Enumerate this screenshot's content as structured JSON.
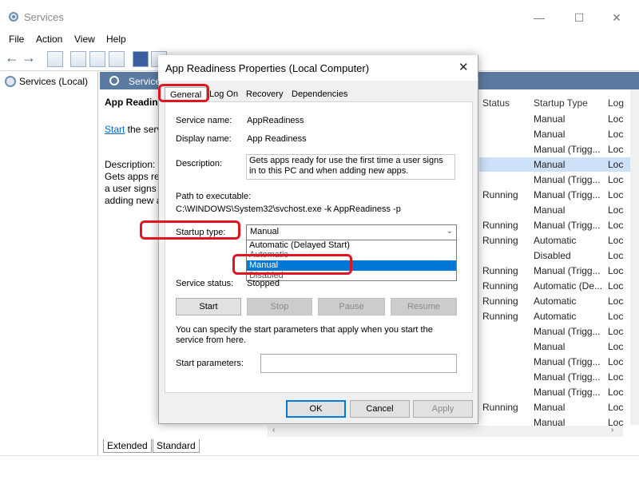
{
  "window": {
    "title": "Services",
    "icons": {
      "app": "services-gear-icon",
      "minimize": "minimize-icon",
      "maximize": "maximize-icon",
      "close": "close-icon"
    },
    "controls": {
      "minimize": "—",
      "maximize": "☐",
      "close": "✕"
    }
  },
  "menu": [
    "File",
    "Action",
    "View",
    "Help"
  ],
  "toolbar": {
    "back": "←",
    "forward": "→",
    "icons": [
      "back-icon",
      "forward-icon",
      "console-tree-icon",
      "properties-icon",
      "refresh-icon",
      "export-icon",
      "help-icon",
      "show-hide-icon",
      "play-icon",
      "stop-icon",
      "pause-icon",
      "restart-icon"
    ]
  },
  "tree": {
    "item": "Services (Local)"
  },
  "pane": {
    "header": "Service",
    "desc_title": "App Readine",
    "start_link": "Start",
    "start_rest": " the serv",
    "desc_label": "Description:",
    "desc_lines": [
      "Gets apps rea",
      "a user signs i",
      "adding new a"
    ]
  },
  "list": {
    "columns": {
      "status": "Status",
      "startup": "Startup Type",
      "logon": "Log"
    },
    "rows": [
      {
        "status": "",
        "startup": "Manual",
        "logon": "Loc"
      },
      {
        "status": "",
        "startup": "Manual",
        "logon": "Loc"
      },
      {
        "status": "",
        "startup": "Manual (Trigg...",
        "logon": "Loc"
      },
      {
        "status": "",
        "startup": "Manual",
        "logon": "Loc"
      },
      {
        "status": "",
        "startup": "Manual (Trigg...",
        "logon": "Loc"
      },
      {
        "status": "Running",
        "startup": "Manual (Trigg...",
        "logon": "Loc"
      },
      {
        "status": "",
        "startup": "Manual",
        "logon": "Loc"
      },
      {
        "status": "Running",
        "startup": "Manual (Trigg...",
        "logon": "Loc"
      },
      {
        "status": "Running",
        "startup": "Automatic",
        "logon": "Loc"
      },
      {
        "status": "",
        "startup": "Disabled",
        "logon": "Loc"
      },
      {
        "status": "Running",
        "startup": "Manual (Trigg...",
        "logon": "Loc"
      },
      {
        "status": "Running",
        "startup": "Automatic (De...",
        "logon": "Loc"
      },
      {
        "status": "Running",
        "startup": "Automatic",
        "logon": "Loc"
      },
      {
        "status": "Running",
        "startup": "Automatic",
        "logon": "Loc"
      },
      {
        "status": "",
        "startup": "Manual (Trigg...",
        "logon": "Loc"
      },
      {
        "status": "",
        "startup": "Manual",
        "logon": "Loc"
      },
      {
        "status": "",
        "startup": "Manual (Trigg...",
        "logon": "Loc"
      },
      {
        "status": "",
        "startup": "Manual (Trigg...",
        "logon": "Loc"
      },
      {
        "status": "",
        "startup": "Manual (Trigg...",
        "logon": "Loc"
      },
      {
        "status": "Running",
        "startup": "Manual",
        "logon": "Loc"
      },
      {
        "status": "",
        "startup": "Manual",
        "logon": "Loc"
      }
    ]
  },
  "bottom_tabs": [
    "Extended",
    "Standard"
  ],
  "dialog": {
    "title": "App Readiness Properties (Local Computer)",
    "close": "✕",
    "tabs": [
      "General",
      "Log On",
      "Recovery",
      "Dependencies"
    ],
    "service_name_label": "Service name:",
    "service_name": "AppReadiness",
    "display_name_label": "Display name:",
    "display_name": "App Readiness",
    "description_label": "Description:",
    "description": "Gets apps ready for use the first time a user signs in to this PC and when adding new apps.",
    "path_label": "Path to executable:",
    "path": "C:\\WINDOWS\\System32\\svchost.exe -k AppReadiness -p",
    "startup_label": "Startup type:",
    "startup_value": "Manual",
    "startup_options": [
      "Automatic (Delayed Start)",
      "Automatic",
      "Manual",
      "Disabled"
    ],
    "service_status_label": "Service status:",
    "service_status": "Stopped",
    "buttons": {
      "start": "Start",
      "stop": "Stop",
      "pause": "Pause",
      "resume": "Resume"
    },
    "note": "You can specify the start parameters that apply when you start the service from here.",
    "start_params_label": "Start parameters:",
    "footer": {
      "ok": "OK",
      "cancel": "Cancel",
      "apply": "Apply"
    },
    "annotation_color": "#e0161e",
    "selection_color": "#0078d7"
  }
}
